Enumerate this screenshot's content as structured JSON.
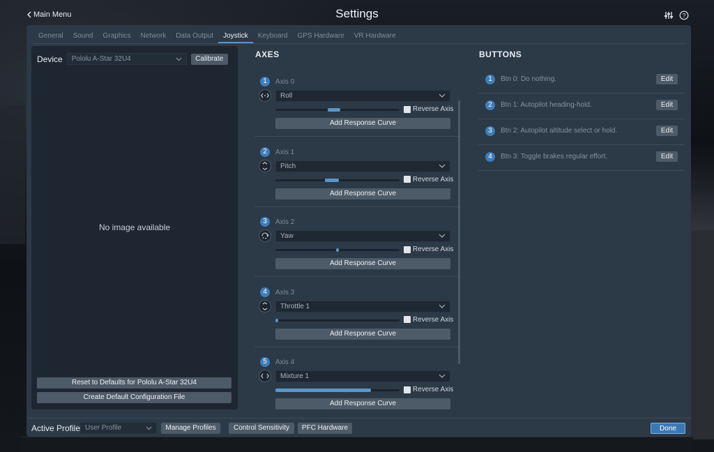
{
  "header": {
    "back_label": "Main Menu",
    "title": "Settings",
    "icons": [
      "sliders-icon",
      "help-icon"
    ]
  },
  "tabs": [
    {
      "label": "General",
      "active": false
    },
    {
      "label": "Sound",
      "active": false
    },
    {
      "label": "Graphics",
      "active": false
    },
    {
      "label": "Network",
      "active": false
    },
    {
      "label": "Data Output",
      "active": false
    },
    {
      "label": "Joystick",
      "active": true
    },
    {
      "label": "Keyboard",
      "active": false
    },
    {
      "label": "GPS Hardware",
      "active": false
    },
    {
      "label": "VR Hardware",
      "active": false
    }
  ],
  "device": {
    "label": "Device",
    "selected": "Pololu A-Star 32U4",
    "calibrate_label": "Calibrate",
    "no_image_text": "No image available",
    "reset_label": "Reset to Defaults for Pololu A-Star 32U4",
    "create_config_label": "Create Default Configuration File"
  },
  "axes": {
    "title": "AXES",
    "reverse_label": "Reverse Axis",
    "curve_label": "Add Response Curve",
    "items": [
      {
        "num": "1",
        "name": "Axis 0",
        "assignment": "Roll",
        "icon": "roll-axis-icon",
        "slider_start": 0.42,
        "slider_end": 0.52
      },
      {
        "num": "2",
        "name": "Axis 1",
        "assignment": "Pitch",
        "icon": "pitch-axis-icon",
        "slider_start": 0.4,
        "slider_end": 0.51
      },
      {
        "num": "3",
        "name": "Axis 2",
        "assignment": "Yaw",
        "icon": "yaw-axis-icon",
        "slider_start": 0.49,
        "slider_end": 0.51
      },
      {
        "num": "4",
        "name": "Axis 3",
        "assignment": "Throttle 1",
        "icon": "throttle-axis-icon",
        "slider_start": 0.0,
        "slider_end": 0.02
      },
      {
        "num": "5",
        "name": "Axis 4",
        "assignment": "Mixture 1",
        "icon": "mixture-axis-icon",
        "slider_start": 0.0,
        "slider_end": 0.77
      }
    ]
  },
  "buttons": {
    "title": "BUTTONS",
    "edit_label": "Edit",
    "items": [
      {
        "num": "1",
        "text": "Btn 0: Do nothing."
      },
      {
        "num": "2",
        "text": "Btn 1: Autopilot heading-hold."
      },
      {
        "num": "3",
        "text": "Btn 2: Autopilot altitude select or hold."
      },
      {
        "num": "4",
        "text": "Btn 3: Toggle brakes regular effort."
      }
    ]
  },
  "footer": {
    "active_profile_label": "Active Profile",
    "profile_selected": "User Profile",
    "manage_profiles_label": "Manage Profiles",
    "control_sensitivity_label": "Control Sensitivity",
    "pfc_hardware_label": "PFC Hardware",
    "done_label": "Done"
  },
  "colors": {
    "accent": "#5b95c8",
    "panel": "#2c3946",
    "done": "#3a79b5"
  }
}
